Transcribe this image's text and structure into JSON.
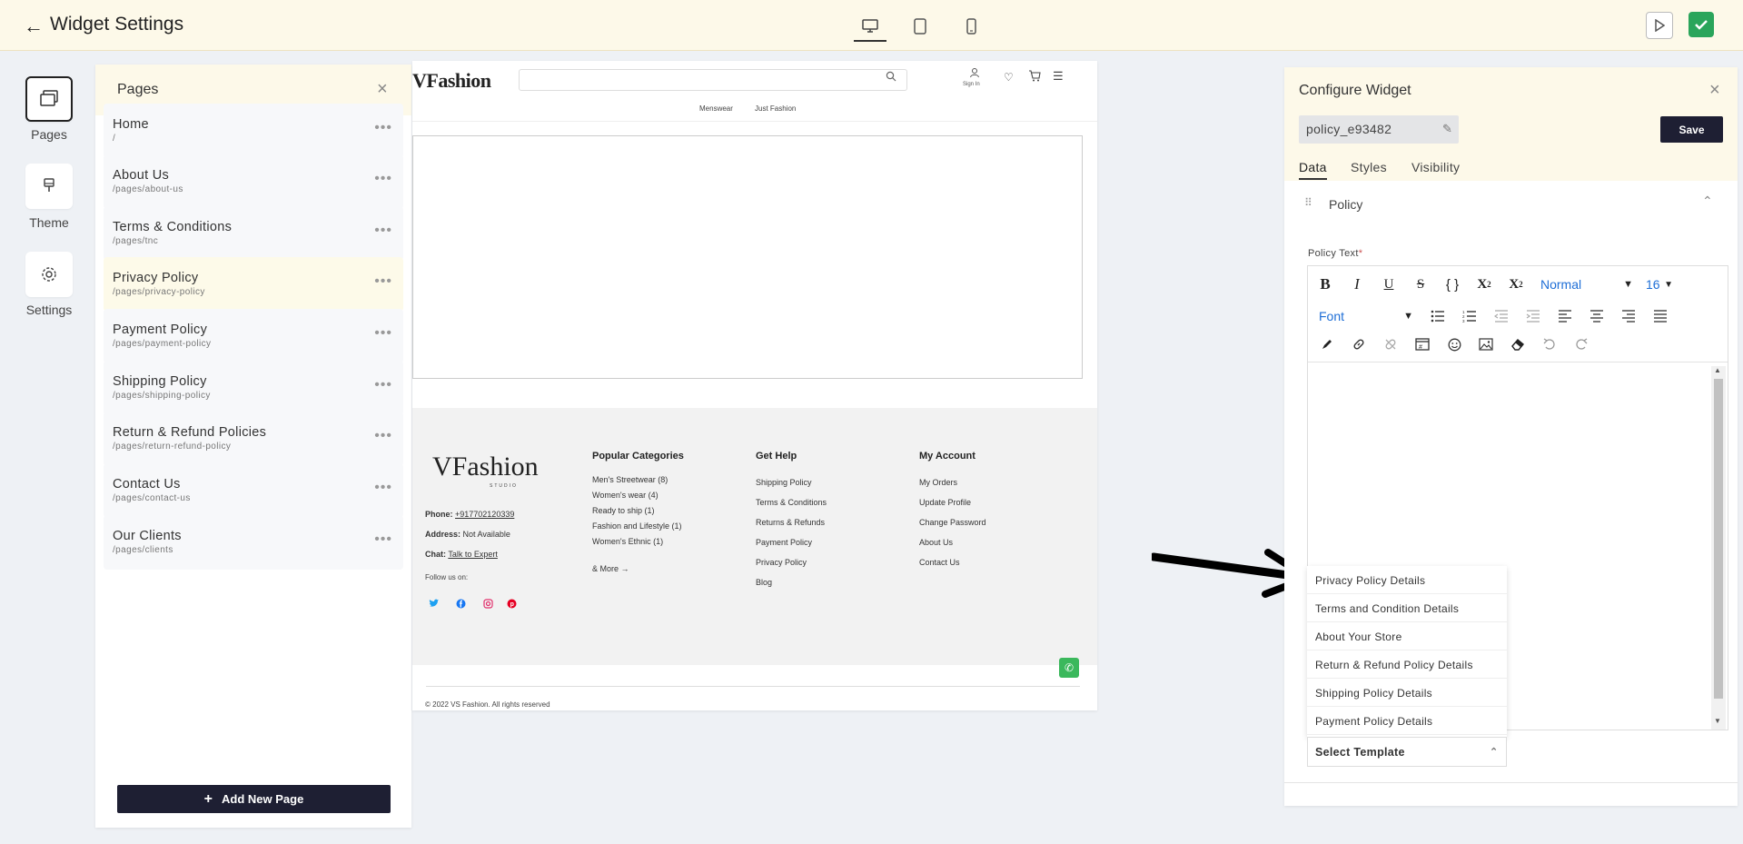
{
  "topbar": {
    "title": "Widget Settings",
    "back_icon": "arrow-left-icon",
    "devices": [
      "desktop-icon",
      "tablet-icon",
      "mobile-icon"
    ]
  },
  "rail": {
    "pages_label": "Pages",
    "theme_label": "Theme",
    "settings_label": "Settings"
  },
  "pages": {
    "title": "Pages",
    "items": [
      {
        "name": "Home",
        "path": "/"
      },
      {
        "name": "About Us",
        "path": "/pages/about-us"
      },
      {
        "name": "Terms & Conditions",
        "path": "/pages/tnc"
      },
      {
        "name": "Privacy Policy",
        "path": "/pages/privacy-policy"
      },
      {
        "name": "Payment Policy",
        "path": "/pages/payment-policy"
      },
      {
        "name": "Shipping Policy",
        "path": "/pages/shipping-policy"
      },
      {
        "name": "Return & Refund Policies",
        "path": "/pages/return-refund-policy"
      },
      {
        "name": "Contact Us",
        "path": "/pages/contact-us"
      },
      {
        "name": "Our Clients",
        "path": "/pages/clients"
      }
    ],
    "active_index": 3,
    "add_button": "Add New Page"
  },
  "preview": {
    "logo": "VFashion",
    "logo_sub": "STUDIO",
    "sign_in": "Sign In",
    "nav": [
      "Menswear",
      "Just Fashion"
    ],
    "footer": {
      "phone_label": "Phone:",
      "phone": "+917702120339",
      "address_label": "Address:",
      "address": "Not Available",
      "chat_label": "Chat:",
      "chat": "Talk to Expert",
      "follow": "Follow us on:",
      "col1_title": "Popular Categories",
      "col1": [
        "Men's Streetwear (8)",
        "Women's wear (4)",
        "Ready to ship (1)",
        "Fashion and Lifestyle (1)",
        "Women's Ethnic (1)"
      ],
      "more": "& More",
      "col2_title": "Get Help",
      "col2": [
        "Shipping Policy",
        "Terms & Conditions",
        "Returns & Refunds",
        "Payment Policy",
        "Privacy Policy",
        "Blog"
      ],
      "col3_title": "My Account",
      "col3": [
        "My Orders",
        "Update Profile",
        "Change Password",
        "About Us",
        "Contact Us"
      ],
      "copyright": "© 2022 VS Fashion. All rights reserved"
    }
  },
  "configure": {
    "title": "Configure Widget",
    "widget_name": "policy_e93482",
    "save": "Save",
    "tabs": [
      "Data",
      "Styles",
      "Visibility"
    ],
    "section": "Policy",
    "field_label": "Policy Text",
    "format_select": "Normal",
    "size_select": "16",
    "font_select": "Font",
    "templates": [
      "Privacy Policy Details",
      "Terms and Condition Details",
      "About Your Store",
      "Return & Refund Policy Details",
      "Shipping Policy Details",
      "Payment Policy Details"
    ],
    "select_template": "Select Template"
  }
}
